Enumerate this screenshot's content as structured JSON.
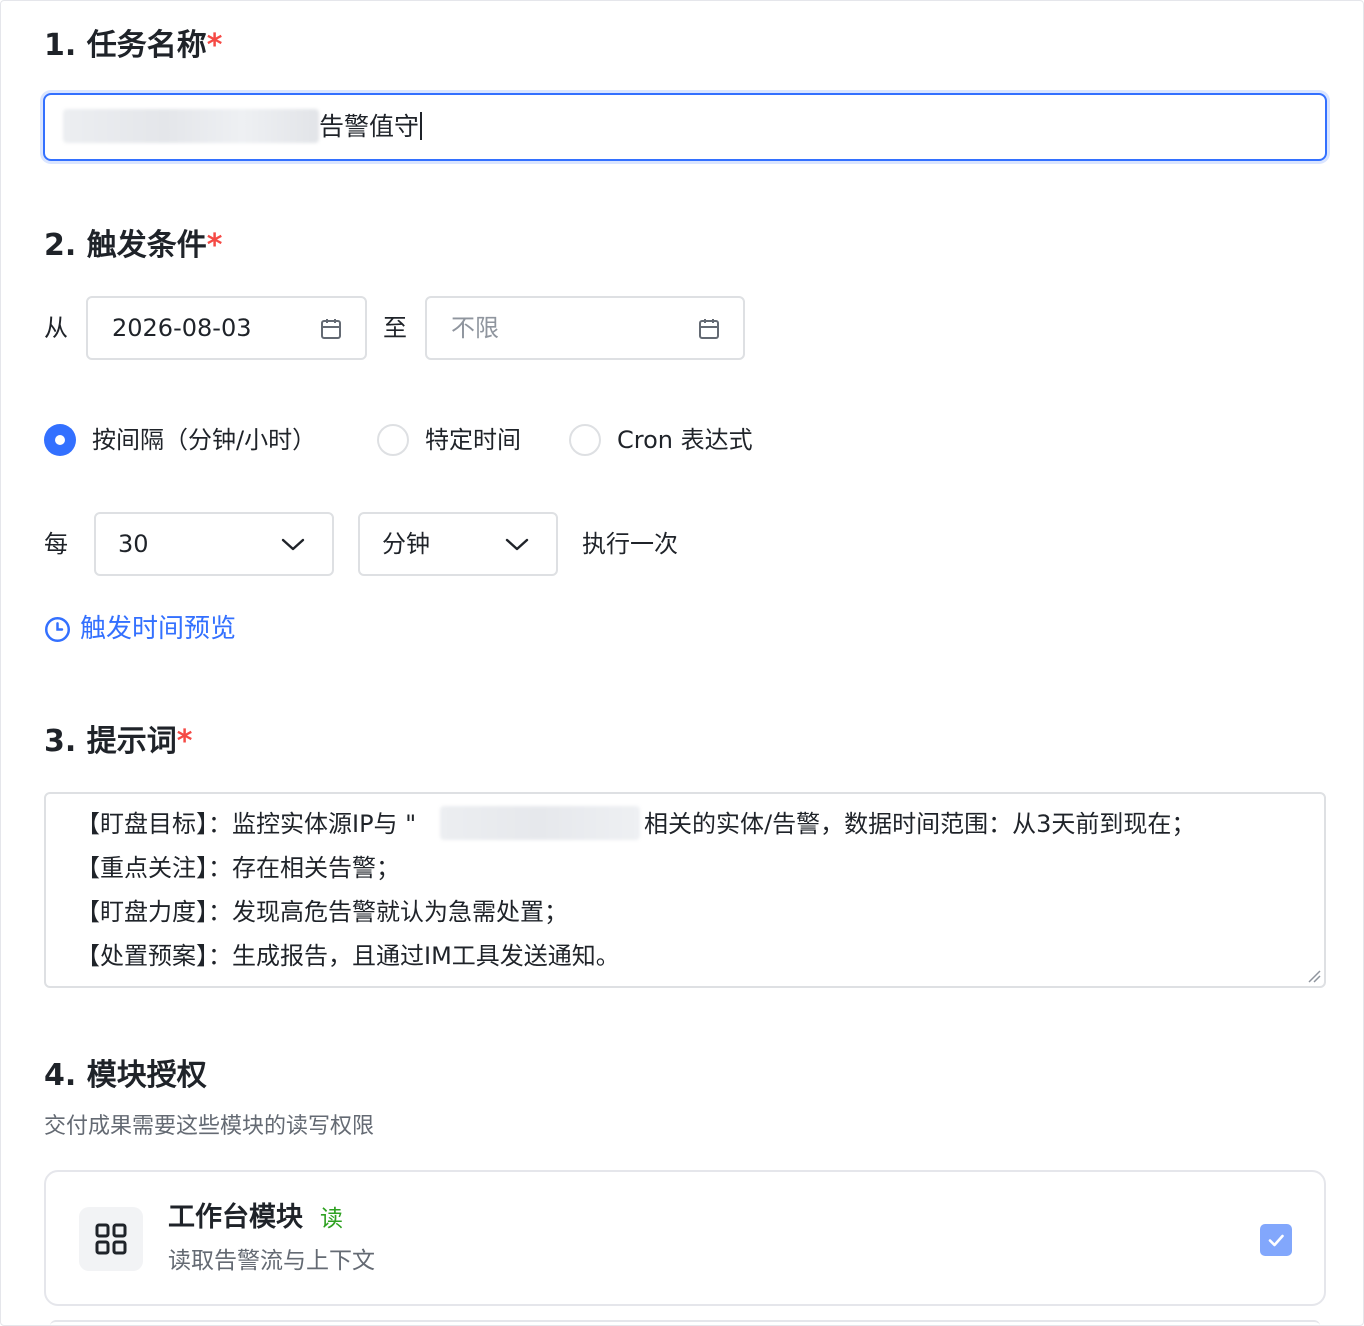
{
  "task_name": {
    "title": "1. 任务名称",
    "required_mark": "*",
    "value": "告警值守"
  },
  "trigger": {
    "title": "2. 触发条件",
    "required_mark": "*",
    "from_label": "从",
    "from_date": "2026-08-03",
    "to_label": "至",
    "to_placeholder": "不限",
    "modes": [
      {
        "label": "按间隔（分钟/小时）",
        "selected": true
      },
      {
        "label": "特定时间",
        "selected": false
      },
      {
        "label": "Cron 表达式",
        "selected": false
      }
    ],
    "every_label": "每",
    "interval_value": "30",
    "unit_value": "分钟",
    "run_once_label": "执行一次",
    "preview_link": "触发时间预览"
  },
  "prompt": {
    "title": "3. 提示词",
    "required_mark": "*",
    "lines": [
      {
        "prefix": "【盯盘目标】：监控实体源IP与 \"",
        "suffix": "相关的实体/告警，数据时间范围：从3天前到现在；"
      },
      {
        "text": "【重点关注】：存在相关告警；"
      },
      {
        "text": "【盯盘力度】：发现高危告警就认为急需处置；"
      },
      {
        "text": "【处置预案】：生成报告，且通过IM工具发送通知。"
      }
    ]
  },
  "modules": {
    "title": "4. 模块授权",
    "subtitle": "交付成果需要这些模块的读写权限",
    "items": [
      {
        "name": "工作台模块",
        "permission": "读",
        "description": "读取告警流与上下文",
        "checked": true,
        "icon": "grid-icon"
      }
    ]
  },
  "colors": {
    "primary": "#3370ff",
    "required": "#f54a45",
    "read_tag": "#2ea121",
    "checkbox_disabled": "#82a7fc"
  }
}
